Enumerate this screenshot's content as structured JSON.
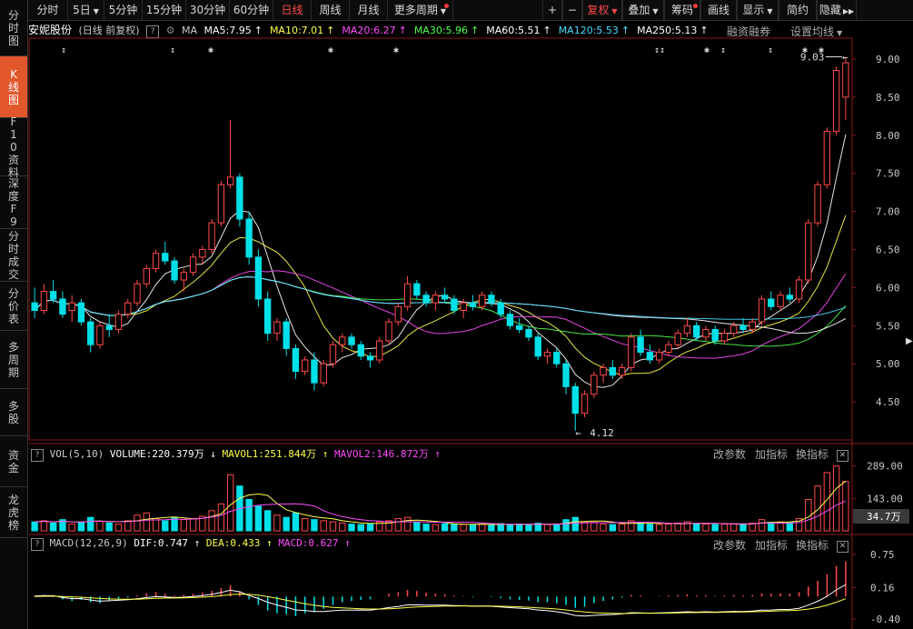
{
  "sidebar": {
    "items": [
      {
        "label": "分时图",
        "active": false
      },
      {
        "label": "K线图",
        "active": true
      },
      {
        "label": "F10资料",
        "active": false
      },
      {
        "label": "深度F9",
        "active": false
      },
      {
        "label": "分时成交",
        "active": false
      },
      {
        "label": "分价表",
        "active": false
      },
      {
        "label": "多周期",
        "active": false
      },
      {
        "label": "多股",
        "active": false
      },
      {
        "label": "资金",
        "active": false
      },
      {
        "label": "龙虎榜",
        "active": false
      }
    ]
  },
  "toolbar": {
    "tabs": [
      {
        "label": "分时",
        "dropdown": false,
        "active": false
      },
      {
        "label": "5日",
        "dropdown": true,
        "active": false
      },
      {
        "label": "5分钟",
        "dropdown": false,
        "active": false
      },
      {
        "label": "15分钟",
        "dropdown": false,
        "active": false
      },
      {
        "label": "30分钟",
        "dropdown": false,
        "active": false
      },
      {
        "label": "60分钟",
        "dropdown": false,
        "active": false
      },
      {
        "label": "日线",
        "dropdown": false,
        "active": true
      },
      {
        "label": "周线",
        "dropdown": false,
        "active": false
      },
      {
        "label": "月线",
        "dropdown": false,
        "active": false
      },
      {
        "label": "更多周期",
        "dropdown": true,
        "active": false
      }
    ],
    "right": [
      {
        "label": "+",
        "dropdown": false,
        "active": false
      },
      {
        "label": "−",
        "dropdown": false,
        "active": false
      },
      {
        "label": "复权",
        "dropdown": true,
        "active": true
      },
      {
        "label": "叠加",
        "dropdown": true,
        "active": false
      },
      {
        "label": "筹码",
        "dropdown": false,
        "active": false
      },
      {
        "label": "画线",
        "dropdown": false,
        "active": false
      },
      {
        "label": "显示",
        "dropdown": true,
        "active": false
      },
      {
        "label": "简约",
        "dropdown": false,
        "active": false
      },
      {
        "label": "隐藏",
        "dropdown": false,
        "active": false
      }
    ]
  },
  "info": {
    "stock_name": "安妮股份",
    "period": "(日线 前复权)",
    "ma_label": "MA",
    "ma": [
      {
        "text": "MA5:7.95",
        "color": "#ffffff"
      },
      {
        "text": "MA10:7.01",
        "color": "#ffff4a"
      },
      {
        "text": "MA20:6.27",
        "color": "#ff4cff"
      },
      {
        "text": "MA30:5.96",
        "color": "#4cff4c"
      },
      {
        "text": "MA60:5.51",
        "color": "#ffffff"
      },
      {
        "text": "MA120:5.53",
        "color": "#4cd9ff"
      },
      {
        "text": "MA250:5.13",
        "color": "#ffffff"
      }
    ],
    "margin": "融资融券",
    "settings": "设置均线"
  },
  "colors": {
    "up": "#ff4a4a",
    "down": "#00e0e8",
    "grid": "#3a0a0a",
    "axis": "#8a1a1a",
    "text": "#c8c8c8"
  },
  "chart_data": {
    "type": "candlestick",
    "price_axis": {
      "ticks": [
        "9.00",
        "8.50",
        "8.00",
        "7.50",
        "7.00",
        "6.50",
        "6.00",
        "5.50",
        "5.00",
        "4.50"
      ],
      "ylim": [
        4.0,
        9.25
      ]
    },
    "annotations": {
      "high": "9.03",
      "low": "4.12",
      "high_value": 9.03,
      "low_value": 4.12
    },
    "candles": [
      [
        5.8,
        6.0,
        5.6,
        5.7
      ],
      [
        5.7,
        6.05,
        5.65,
        5.95
      ],
      [
        5.95,
        6.1,
        5.8,
        5.85
      ],
      [
        5.85,
        5.95,
        5.6,
        5.65
      ],
      [
        5.7,
        5.9,
        5.55,
        5.8
      ],
      [
        5.8,
        5.85,
        5.5,
        5.55
      ],
      [
        5.55,
        5.6,
        5.15,
        5.25
      ],
      [
        5.25,
        5.55,
        5.2,
        5.5
      ],
      [
        5.5,
        5.65,
        5.35,
        5.45
      ],
      [
        5.45,
        5.7,
        5.4,
        5.65
      ],
      [
        5.65,
        5.85,
        5.6,
        5.8
      ],
      [
        5.8,
        6.1,
        5.75,
        6.05
      ],
      [
        6.05,
        6.3,
        6.0,
        6.25
      ],
      [
        6.25,
        6.5,
        6.2,
        6.45
      ],
      [
        6.45,
        6.6,
        6.3,
        6.35
      ],
      [
        6.35,
        6.4,
        6.05,
        6.1
      ],
      [
        6.1,
        6.25,
        5.95,
        6.2
      ],
      [
        6.2,
        6.45,
        6.15,
        6.4
      ],
      [
        6.4,
        6.55,
        6.3,
        6.5
      ],
      [
        6.5,
        6.9,
        6.45,
        6.85
      ],
      [
        6.85,
        7.4,
        6.8,
        7.35
      ],
      [
        7.35,
        8.2,
        7.3,
        7.45
      ],
      [
        7.45,
        7.5,
        6.8,
        6.9
      ],
      [
        6.9,
        7.0,
        6.3,
        6.4
      ],
      [
        6.4,
        6.5,
        5.75,
        5.85
      ],
      [
        5.85,
        5.95,
        5.3,
        5.4
      ],
      [
        5.4,
        5.6,
        5.3,
        5.55
      ],
      [
        5.55,
        5.6,
        5.1,
        5.2
      ],
      [
        5.2,
        5.25,
        4.8,
        4.9
      ],
      [
        4.9,
        5.1,
        4.85,
        5.05
      ],
      [
        5.05,
        5.15,
        4.65,
        4.75
      ],
      [
        4.75,
        5.05,
        4.7,
        5.0
      ],
      [
        5.0,
        5.3,
        4.95,
        5.25
      ],
      [
        5.25,
        5.4,
        5.15,
        5.35
      ],
      [
        5.35,
        5.4,
        5.2,
        5.25
      ],
      [
        5.25,
        5.3,
        5.05,
        5.1
      ],
      [
        5.1,
        5.15,
        4.95,
        5.05
      ],
      [
        5.05,
        5.35,
        5.0,
        5.3
      ],
      [
        5.3,
        5.6,
        5.25,
        5.55
      ],
      [
        5.55,
        5.8,
        5.5,
        5.75
      ],
      [
        5.75,
        6.15,
        5.7,
        6.05
      ],
      [
        6.05,
        6.1,
        5.85,
        5.9
      ],
      [
        5.9,
        5.95,
        5.75,
        5.8
      ],
      [
        5.8,
        5.95,
        5.7,
        5.9
      ],
      [
        5.9,
        6.0,
        5.8,
        5.85
      ],
      [
        5.85,
        5.9,
        5.65,
        5.7
      ],
      [
        5.7,
        5.85,
        5.6,
        5.8
      ],
      [
        5.8,
        5.9,
        5.7,
        5.75
      ],
      [
        5.75,
        5.95,
        5.7,
        5.9
      ],
      [
        5.9,
        5.95,
        5.75,
        5.8
      ],
      [
        5.8,
        5.85,
        5.6,
        5.65
      ],
      [
        5.65,
        5.7,
        5.45,
        5.5
      ],
      [
        5.5,
        5.6,
        5.4,
        5.45
      ],
      [
        5.45,
        5.5,
        5.3,
        5.35
      ],
      [
        5.35,
        5.4,
        5.05,
        5.1
      ],
      [
        5.1,
        5.2,
        5.0,
        5.15
      ],
      [
        5.15,
        5.2,
        4.95,
        5.0
      ],
      [
        5.0,
        5.05,
        4.6,
        4.7
      ],
      [
        4.7,
        4.75,
        4.12,
        4.35
      ],
      [
        4.35,
        4.65,
        4.3,
        4.6
      ],
      [
        4.6,
        4.9,
        4.55,
        4.85
      ],
      [
        4.85,
        5.0,
        4.75,
        4.95
      ],
      [
        4.95,
        5.05,
        4.8,
        4.85
      ],
      [
        4.85,
        5.0,
        4.8,
        4.95
      ],
      [
        4.95,
        5.4,
        4.9,
        5.35
      ],
      [
        5.35,
        5.45,
        5.1,
        5.15
      ],
      [
        5.15,
        5.25,
        5.0,
        5.05
      ],
      [
        5.05,
        5.2,
        5.0,
        5.15
      ],
      [
        5.15,
        5.3,
        5.1,
        5.25
      ],
      [
        5.25,
        5.45,
        5.2,
        5.4
      ],
      [
        5.4,
        5.6,
        5.35,
        5.5
      ],
      [
        5.5,
        5.55,
        5.3,
        5.35
      ],
      [
        5.35,
        5.5,
        5.3,
        5.45
      ],
      [
        5.45,
        5.5,
        5.25,
        5.3
      ],
      [
        5.3,
        5.45,
        5.25,
        5.4
      ],
      [
        5.4,
        5.55,
        5.35,
        5.5
      ],
      [
        5.5,
        5.6,
        5.4,
        5.45
      ],
      [
        5.45,
        5.6,
        5.4,
        5.55
      ],
      [
        5.55,
        5.9,
        5.5,
        5.85
      ],
      [
        5.85,
        5.95,
        5.7,
        5.75
      ],
      [
        5.75,
        5.95,
        5.7,
        5.9
      ],
      [
        5.9,
        6.0,
        5.8,
        5.85
      ],
      [
        5.85,
        6.15,
        5.8,
        6.1
      ],
      [
        6.1,
        6.9,
        6.05,
        6.85
      ],
      [
        6.85,
        7.4,
        6.8,
        7.35
      ],
      [
        7.35,
        8.1,
        7.3,
        8.05
      ],
      [
        8.05,
        8.9,
        8.0,
        8.85
      ],
      [
        8.5,
        9.03,
        8.2,
        8.95
      ]
    ],
    "volume": {
      "label": "VOL(5,10)",
      "volume": "VOLUME:220.379万",
      "mavol1": "MAVOL1:251.844万",
      "mavol2": "MAVOL2:146.872万",
      "ticks": [
        "289.00",
        "143.00"
      ],
      "current": "34.7万",
      "ylim": [
        0,
        300
      ]
    },
    "volumes": [
      40,
      45,
      35,
      50,
      30,
      38,
      60,
      42,
      35,
      30,
      45,
      70,
      80,
      55,
      45,
      60,
      50,
      55,
      65,
      90,
      120,
      250,
      200,
      140,
      110,
      90,
      70,
      60,
      80,
      55,
      50,
      45,
      40,
      35,
      30,
      28,
      32,
      40,
      45,
      55,
      60,
      38,
      30,
      28,
      32,
      30,
      28,
      26,
      30,
      28,
      32,
      28,
      30,
      26,
      34,
      28,
      30,
      50,
      60,
      40,
      38,
      30,
      28,
      30,
      45,
      35,
      30,
      28,
      30,
      35,
      40,
      32,
      30,
      28,
      30,
      32,
      30,
      34,
      50,
      38,
      40,
      36,
      55,
      140,
      200,
      260,
      289,
      220
    ],
    "macd": {
      "label": "MACD(12,26,9)",
      "dif": "DIF:0.747",
      "dea": "DEA:0.433",
      "macd": "MACD:0.627",
      "ticks": [
        "0.75",
        "0.16",
        "-0.40"
      ],
      "ylim": [
        -0.45,
        0.85
      ]
    },
    "macd_hist": [
      0.02,
      0.03,
      0.02,
      -0.05,
      -0.08,
      -0.06,
      -0.1,
      -0.12,
      -0.08,
      -0.05,
      -0.02,
      0.02,
      0.06,
      0.08,
      0.05,
      0.02,
      0.03,
      0.05,
      0.07,
      0.1,
      0.15,
      0.2,
      0.1,
      -0.05,
      -0.15,
      -0.25,
      -0.3,
      -0.32,
      -0.35,
      -0.3,
      -0.28,
      -0.22,
      -0.15,
      -0.1,
      -0.08,
      -0.06,
      -0.05,
      0.0,
      0.05,
      0.08,
      0.12,
      0.1,
      0.07,
      0.05,
      0.04,
      0.02,
      0.01,
      -0.01,
      0.0,
      -0.01,
      -0.03,
      -0.05,
      -0.06,
      -0.07,
      -0.1,
      -0.1,
      -0.12,
      -0.15,
      -0.2,
      -0.18,
      -0.12,
      -0.08,
      -0.05,
      -0.02,
      0.03,
      0.02,
      0.0,
      0.01,
      0.02,
      0.03,
      0.04,
      0.02,
      0.03,
      0.01,
      0.02,
      0.03,
      0.02,
      0.03,
      0.06,
      0.05,
      0.06,
      0.05,
      0.08,
      0.18,
      0.28,
      0.4,
      0.55,
      0.627
    ],
    "buttons": {
      "modify": "改参数",
      "add": "加指标",
      "switch": "换指标"
    }
  }
}
